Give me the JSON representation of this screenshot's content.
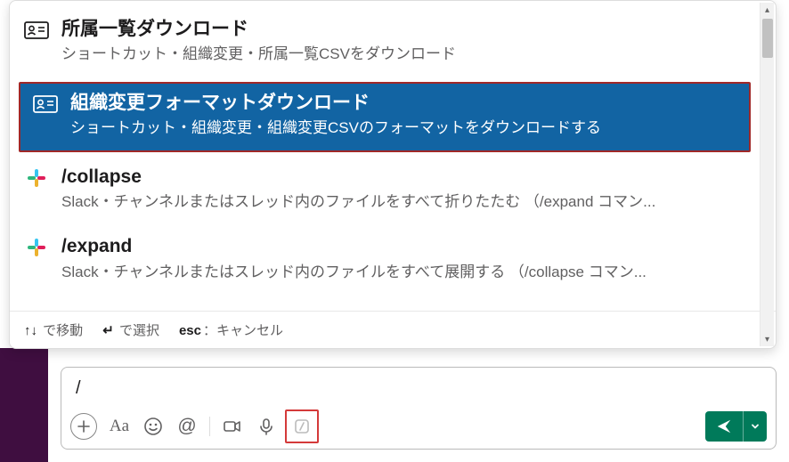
{
  "shortcuts": [
    {
      "icon": "id-card-icon",
      "title": "所属一覧ダウンロード",
      "desc": "ショートカット・組織変更・所属一覧CSVをダウンロード",
      "highlighted": false
    },
    {
      "icon": "id-card-icon",
      "title": "組織変更フォーマットダウンロード",
      "desc": "ショートカット・組織変更・組織変更CSVのフォーマットをダウンロードする",
      "highlighted": true
    },
    {
      "icon": "slack-icon",
      "title": "/collapse",
      "desc": "Slack・チャンネルまたはスレッド内のファイルをすべて折りたたむ （/expand コマン...",
      "highlighted": false
    },
    {
      "icon": "slack-icon",
      "title": "/expand",
      "desc": "Slack・チャンネルまたはスレッド内のファイルをすべて展開する （/collapse コマン...",
      "highlighted": false
    }
  ],
  "hints": {
    "nav_keys": "↑↓",
    "nav_label": "で移動",
    "select_keys": "↵",
    "select_label": "で選択",
    "cancel_keys": "esc",
    "cancel_label": "：キャンセル"
  },
  "composer": {
    "input_value": "/",
    "toolbar": {
      "plus": "+",
      "format": "Aa",
      "emoji": "☺",
      "mention": "@",
      "video": "video",
      "audio": "mic",
      "slash": "slash",
      "send": "send"
    }
  },
  "colors": {
    "highlight_bg": "#1264a3",
    "highlight_border": "#a02828",
    "send_bg": "#007a5a",
    "sidebar_bg": "#3f0e40"
  }
}
